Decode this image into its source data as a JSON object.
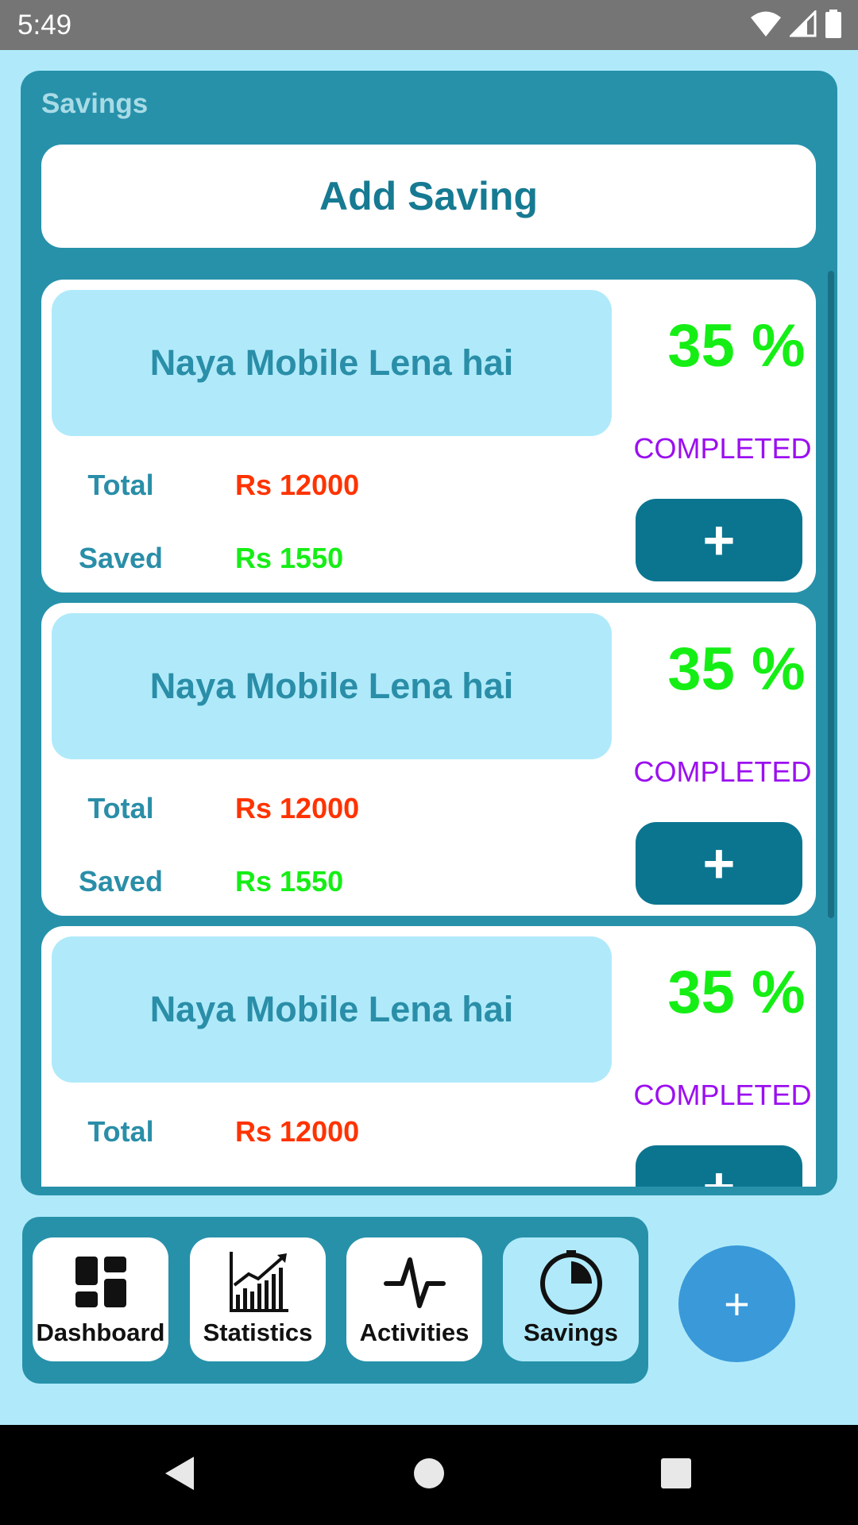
{
  "status_bar": {
    "time": "5:49",
    "icons": [
      "wifi-icon",
      "signal-icon",
      "battery-icon"
    ]
  },
  "panel": {
    "title": "Savings",
    "add_button_label": "Add Saving"
  },
  "savings": [
    {
      "name": "Naya Mobile Lena hai",
      "percent": "35 %",
      "status": "COMPLETED",
      "total_label": "Total",
      "total_value": "Rs 12000",
      "saved_label": "Saved",
      "saved_value": "Rs 1550",
      "add_label": "+"
    },
    {
      "name": "Naya Mobile Lena hai",
      "percent": "35 %",
      "status": "COMPLETED",
      "total_label": "Total",
      "total_value": "Rs 12000",
      "saved_label": "Saved",
      "saved_value": "Rs 1550",
      "add_label": "+"
    },
    {
      "name": "Naya Mobile Lena hai",
      "percent": "35 %",
      "status": "COMPLETED",
      "total_label": "Total",
      "total_value": "Rs 12000",
      "add_label": "+"
    }
  ],
  "bottom_nav": {
    "items": [
      {
        "label": "Dashboard",
        "icon": "dashboard-icon"
      },
      {
        "label": "Statistics",
        "icon": "statistics-icon"
      },
      {
        "label": "Activities",
        "icon": "activities-icon"
      },
      {
        "label": "Savings",
        "icon": "savings-icon",
        "active": true
      }
    ]
  },
  "fab": {
    "label": "+"
  },
  "colors": {
    "background": "#b0eafa",
    "panel": "#2791aa",
    "button": "#0b7590",
    "total_value": "#ff3300",
    "saved_value": "#15ee15",
    "completed": "#9b0ff0",
    "fab": "#3a99d9"
  }
}
